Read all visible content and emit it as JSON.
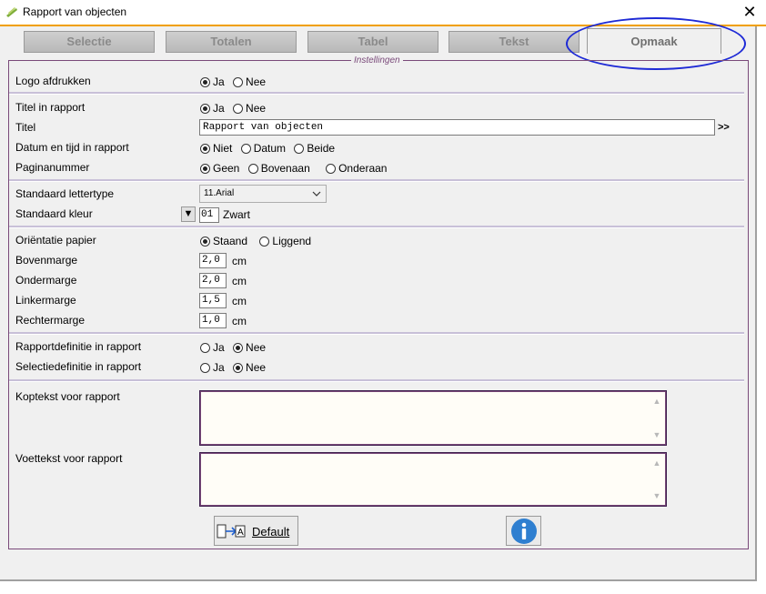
{
  "window": {
    "title": "Rapport van objecten",
    "close_glyph": "✕"
  },
  "tabs": [
    {
      "label": "Selectie"
    },
    {
      "label": "Totalen"
    },
    {
      "label": "Tabel"
    },
    {
      "label": "Tekst"
    },
    {
      "label": "Opmaak",
      "active": true
    }
  ],
  "group": {
    "legend": "Instellingen"
  },
  "rows": {
    "logo": {
      "label": "Logo afdrukken",
      "options": [
        "Ja",
        "Nee"
      ],
      "selected": "Ja"
    },
    "titel_in_rapport": {
      "label": "Titel in rapport",
      "options": [
        "Ja",
        "Nee"
      ],
      "selected": "Ja"
    },
    "titel": {
      "label": "Titel",
      "value": "Rapport van objecten",
      "more": ">>"
    },
    "datum": {
      "label": "Datum en tijd in rapport",
      "options": [
        "Niet",
        "Datum",
        "Beide"
      ],
      "selected": "Niet"
    },
    "pagina": {
      "label": "Paginanummer",
      "options": [
        "Geen",
        "Bovenaan",
        "Onderaan"
      ],
      "selected": "Geen"
    },
    "lettertype": {
      "label": "Standaard lettertype",
      "value": "11.Arial"
    },
    "kleur": {
      "label": "Standaard kleur",
      "code": "01",
      "name": "Zwart"
    },
    "orientatie": {
      "label": "Oriëntatie papier",
      "options": [
        "Staand",
        "Liggend"
      ],
      "selected": "Staand"
    },
    "bovenmarge": {
      "label": "Bovenmarge",
      "value": "2,0",
      "unit": "cm"
    },
    "ondermarge": {
      "label": "Ondermarge",
      "value": "2,0",
      "unit": "cm"
    },
    "linkermarge": {
      "label": "Linkermarge",
      "value": "1,5",
      "unit": "cm"
    },
    "rechtermarge": {
      "label": "Rechtermarge",
      "value": "1,0",
      "unit": "cm"
    },
    "rapportdef": {
      "label": "Rapportdefinitie in rapport",
      "options": [
        "Ja",
        "Nee"
      ],
      "selected": "Nee"
    },
    "selectiedef": {
      "label": "Selectiedefinitie in rapport",
      "options": [
        "Ja",
        "Nee"
      ],
      "selected": "Nee"
    },
    "koptekst": {
      "label": "Koptekst voor rapport",
      "value": ""
    },
    "voettekst": {
      "label": "Voettekst voor rapport",
      "value": ""
    }
  },
  "buttons": {
    "default_label": "Default",
    "default_icon": "field-to-text-icon",
    "info_icon": "info-icon"
  },
  "colors": {
    "accent": "#f0a000",
    "highlight": "#1e2ad6",
    "group_border": "#7a4a7a",
    "info": "#2f7fd0"
  }
}
